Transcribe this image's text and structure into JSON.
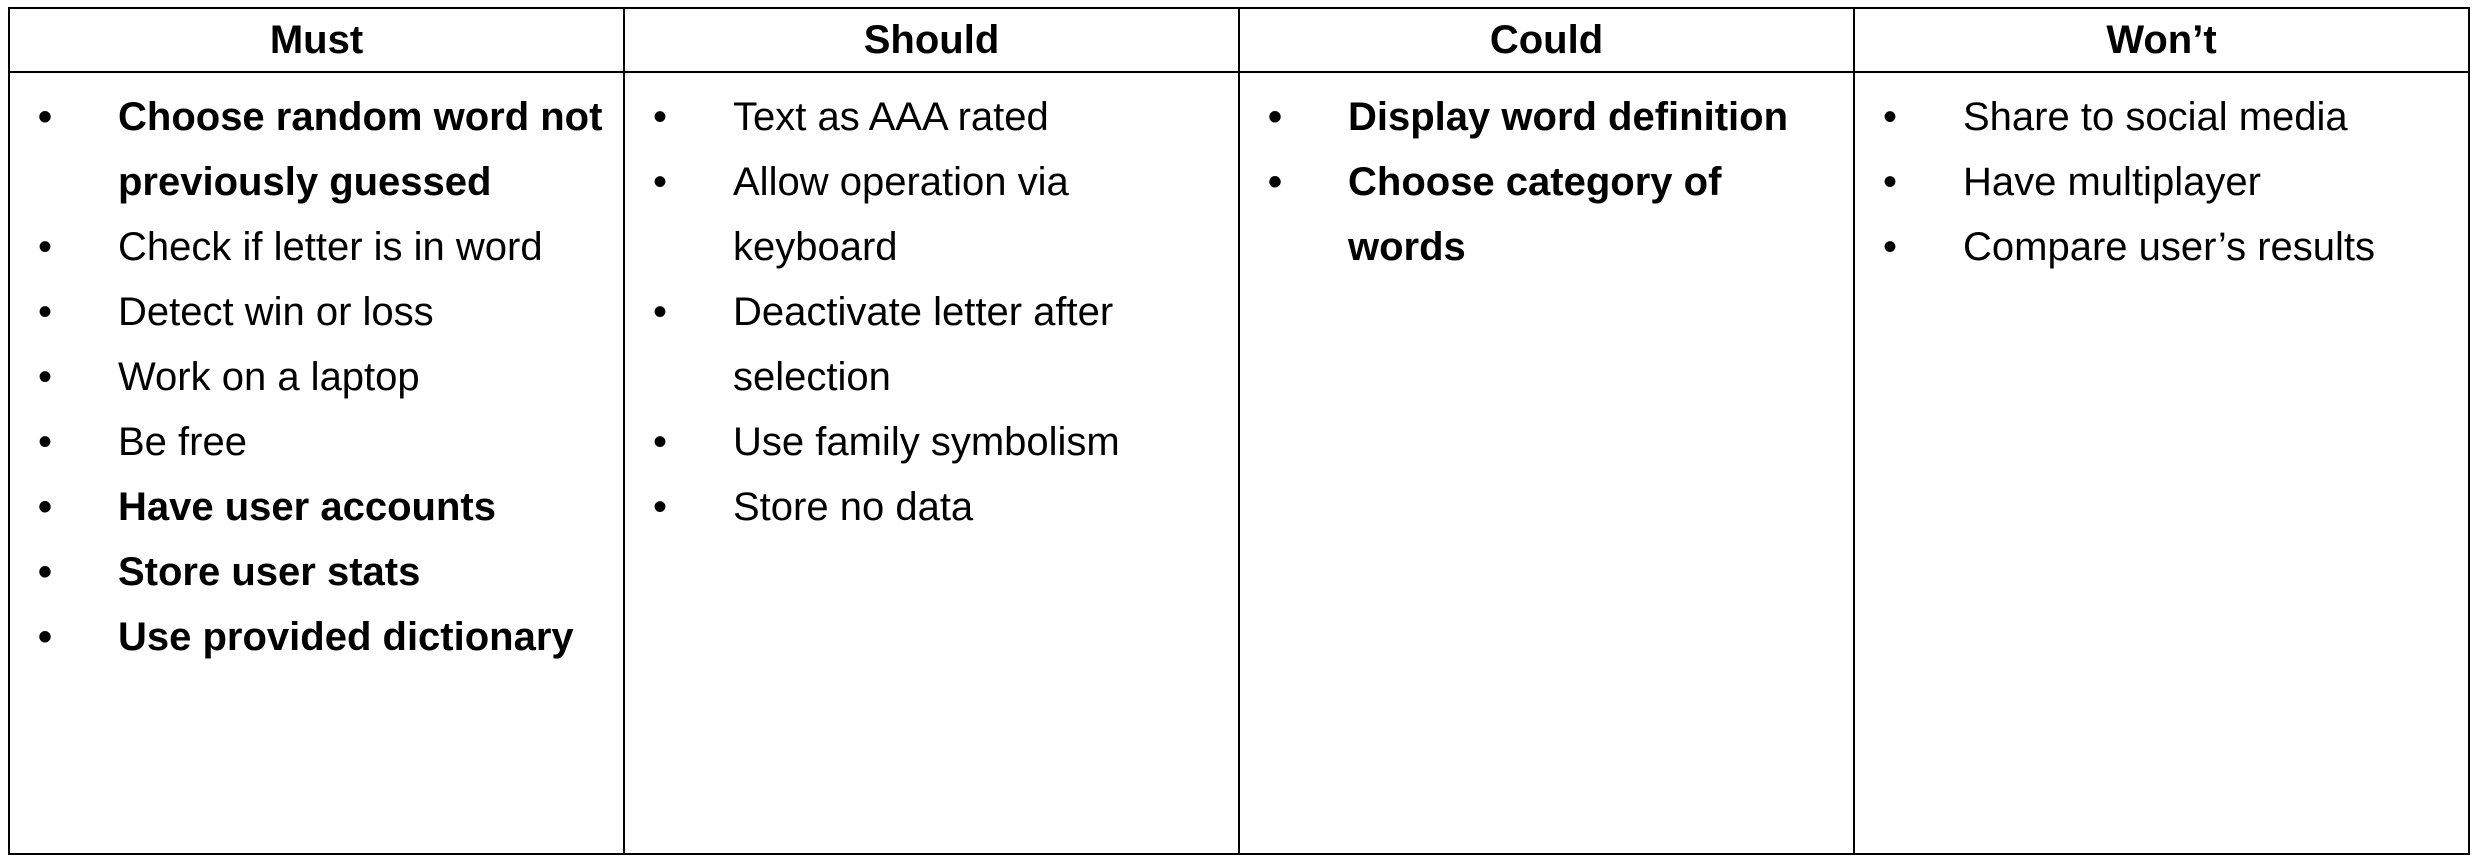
{
  "columns": [
    {
      "header": "Must",
      "items": [
        {
          "text": "Choose random word not previously guessed",
          "bold": true
        },
        {
          "text": "Check if letter is in word",
          "bold": false
        },
        {
          "text": "Detect win or loss",
          "bold": false
        },
        {
          "text": "Work on a laptop",
          "bold": false
        },
        {
          "text": "Be free",
          "bold": false
        },
        {
          "text": "Have user accounts",
          "bold": true
        },
        {
          "text": "Store user stats",
          "bold": true
        },
        {
          "text": "Use provided dictionary",
          "bold": true
        }
      ]
    },
    {
      "header": "Should",
      "items": [
        {
          "text": "Text as AAA rated",
          "bold": false
        },
        {
          "text": "Allow operation via keyboard",
          "bold": false
        },
        {
          "text": "Deactivate letter after selection",
          "bold": false
        },
        {
          "text": "Use family symbolism",
          "bold": false
        },
        {
          "text": "Store no data",
          "bold": false
        }
      ]
    },
    {
      "header": "Could",
      "items": [
        {
          "text": "Display word definition",
          "bold": true
        },
        {
          "text": "Choose category of words",
          "bold": true
        }
      ]
    },
    {
      "header": "Won’t",
      "items": [
        {
          "text": "Share to social media",
          "bold": false
        },
        {
          "text": "Have multiplayer",
          "bold": false
        },
        {
          "text": "Compare user’s results",
          "bold": false
        }
      ]
    }
  ]
}
